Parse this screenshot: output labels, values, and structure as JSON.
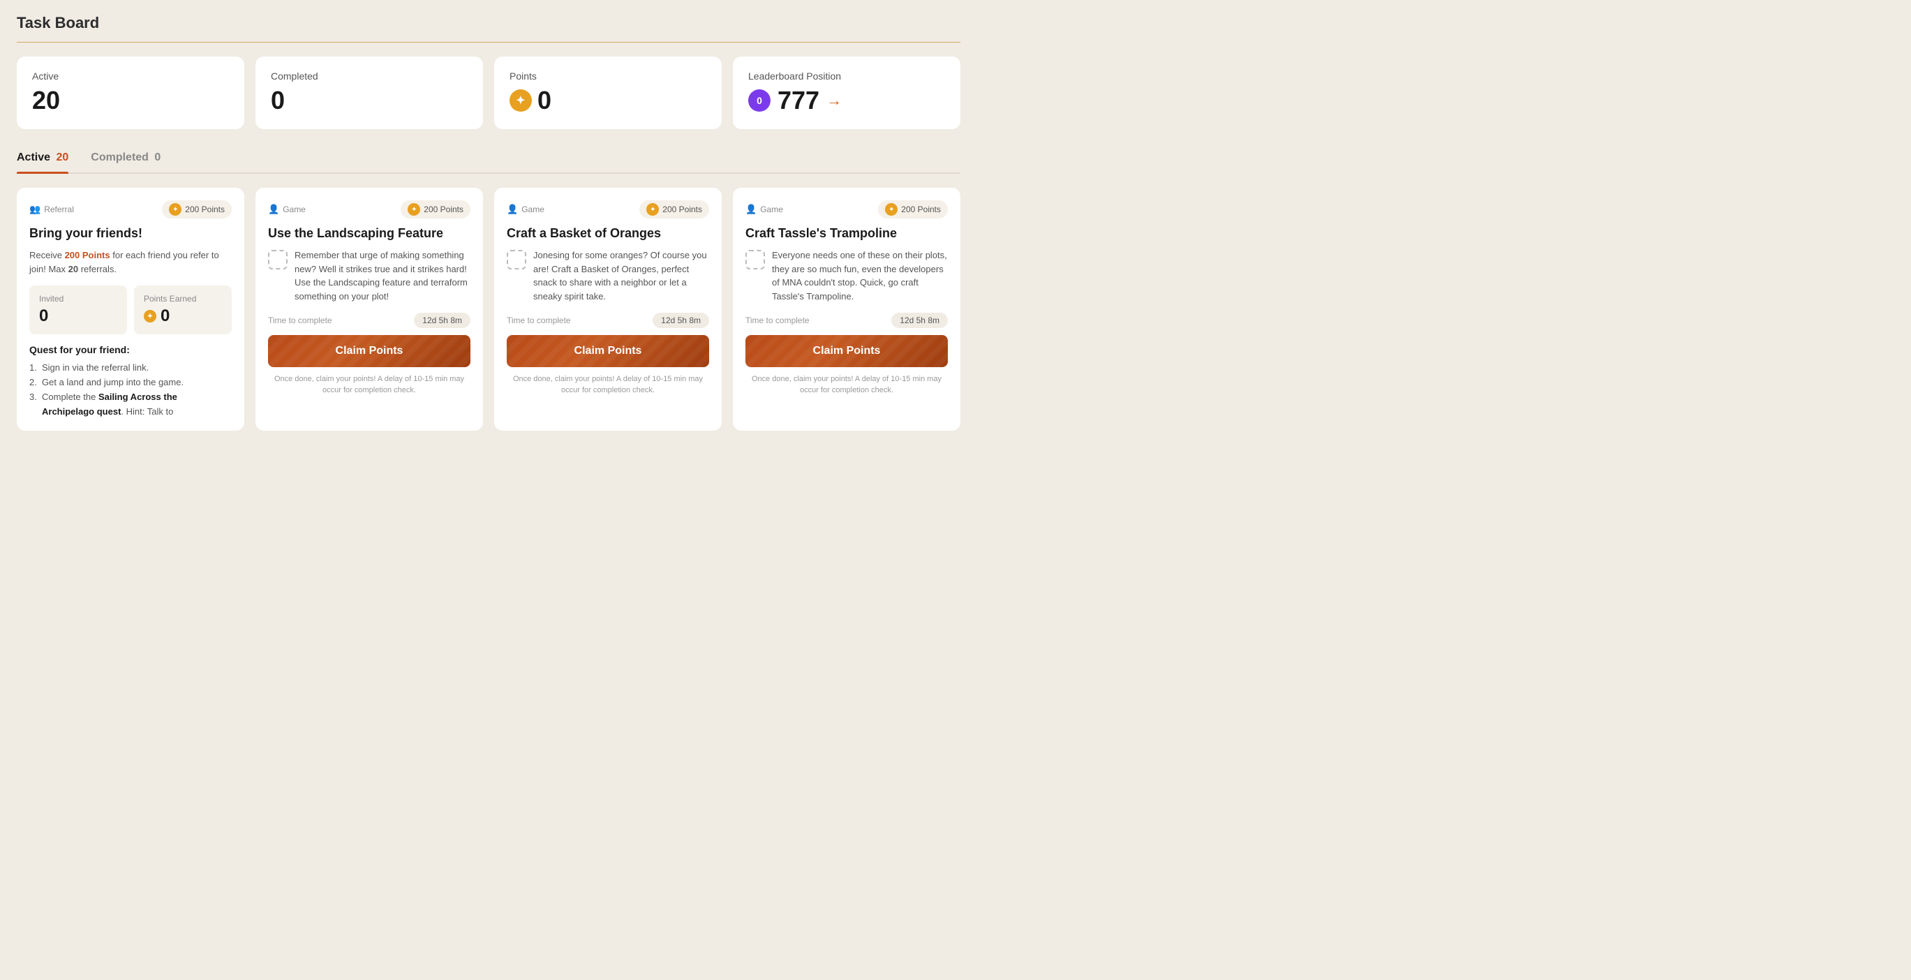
{
  "page": {
    "title": "Task Board"
  },
  "stats": [
    {
      "id": "active",
      "label": "Active",
      "value": "20",
      "type": "plain"
    },
    {
      "id": "completed",
      "label": "Completed",
      "value": "0",
      "type": "plain"
    },
    {
      "id": "points",
      "label": "Points",
      "value": "0",
      "type": "star"
    },
    {
      "id": "leaderboard",
      "label": "Leaderboard Position",
      "value": "777",
      "circle": "0",
      "type": "leaderboard"
    }
  ],
  "tabs": [
    {
      "id": "active",
      "label": "Active",
      "count": "20",
      "active": true
    },
    {
      "id": "completed",
      "label": "Completed",
      "count": "0",
      "active": false
    }
  ],
  "cards": [
    {
      "id": "referral",
      "type_label": "Referral",
      "type_icon": "👥",
      "points": "200 Points",
      "title": "Bring your friends!",
      "is_referral": true,
      "referral_intro": "Receive",
      "referral_highlight": "200 Points",
      "referral_after": "for each friend you refer to join! Max",
      "referral_max": "20",
      "referral_end": "referrals.",
      "invited_label": "Invited",
      "invited_value": "0",
      "points_earned_label": "Points Earned",
      "points_earned_value": "0",
      "quest_title": "Quest for your friend:",
      "quest_items": [
        "Sign in via the referral link.",
        "Get a land and jump into the game.",
        "Complete the {bold}Sailing Across the Archipelago quest{/bold}. Hint: Talk to"
      ]
    },
    {
      "id": "landscaping",
      "type_label": "Game",
      "type_icon": "👤",
      "points": "200 Points",
      "title": "Use the Landscaping Feature",
      "desc": "Remember that urge of making something new? Well it strikes true and it strikes hard! Use the Landscaping feature and terraform something on your plot!",
      "time_label": "Time to complete",
      "time_value": "12d 5h 8m",
      "btn_label": "Claim Points",
      "note": "Once done, claim your points! A delay of 10-15 min may occur for completion check."
    },
    {
      "id": "basket-oranges",
      "type_label": "Game",
      "type_icon": "👤",
      "points": "200 Points",
      "title": "Craft a Basket of Oranges",
      "desc": "Jonesing for some oranges? Of course you are! Craft a Basket of Oranges, perfect snack to share with a neighbor or let a sneaky spirit take.",
      "time_label": "Time to complete",
      "time_value": "12d 5h 8m",
      "btn_label": "Claim Points",
      "note": "Once done, claim your points! A delay of 10-15 min may occur for completion check."
    },
    {
      "id": "trampoline",
      "type_label": "Game",
      "type_icon": "👤",
      "points": "200 Points",
      "title": "Craft Tassle's Trampoline",
      "desc": "Everyone needs one of these on their plots, they are so much fun, even the developers of MNA couldn't stop. Quick, go craft Tassle's Trampoline.",
      "time_label": "Time to complete",
      "time_value": "12d 5h 8m",
      "btn_label": "Claim Points",
      "note": "Once done, claim your points! A delay of 10-15 min may occur for completion check."
    }
  ]
}
